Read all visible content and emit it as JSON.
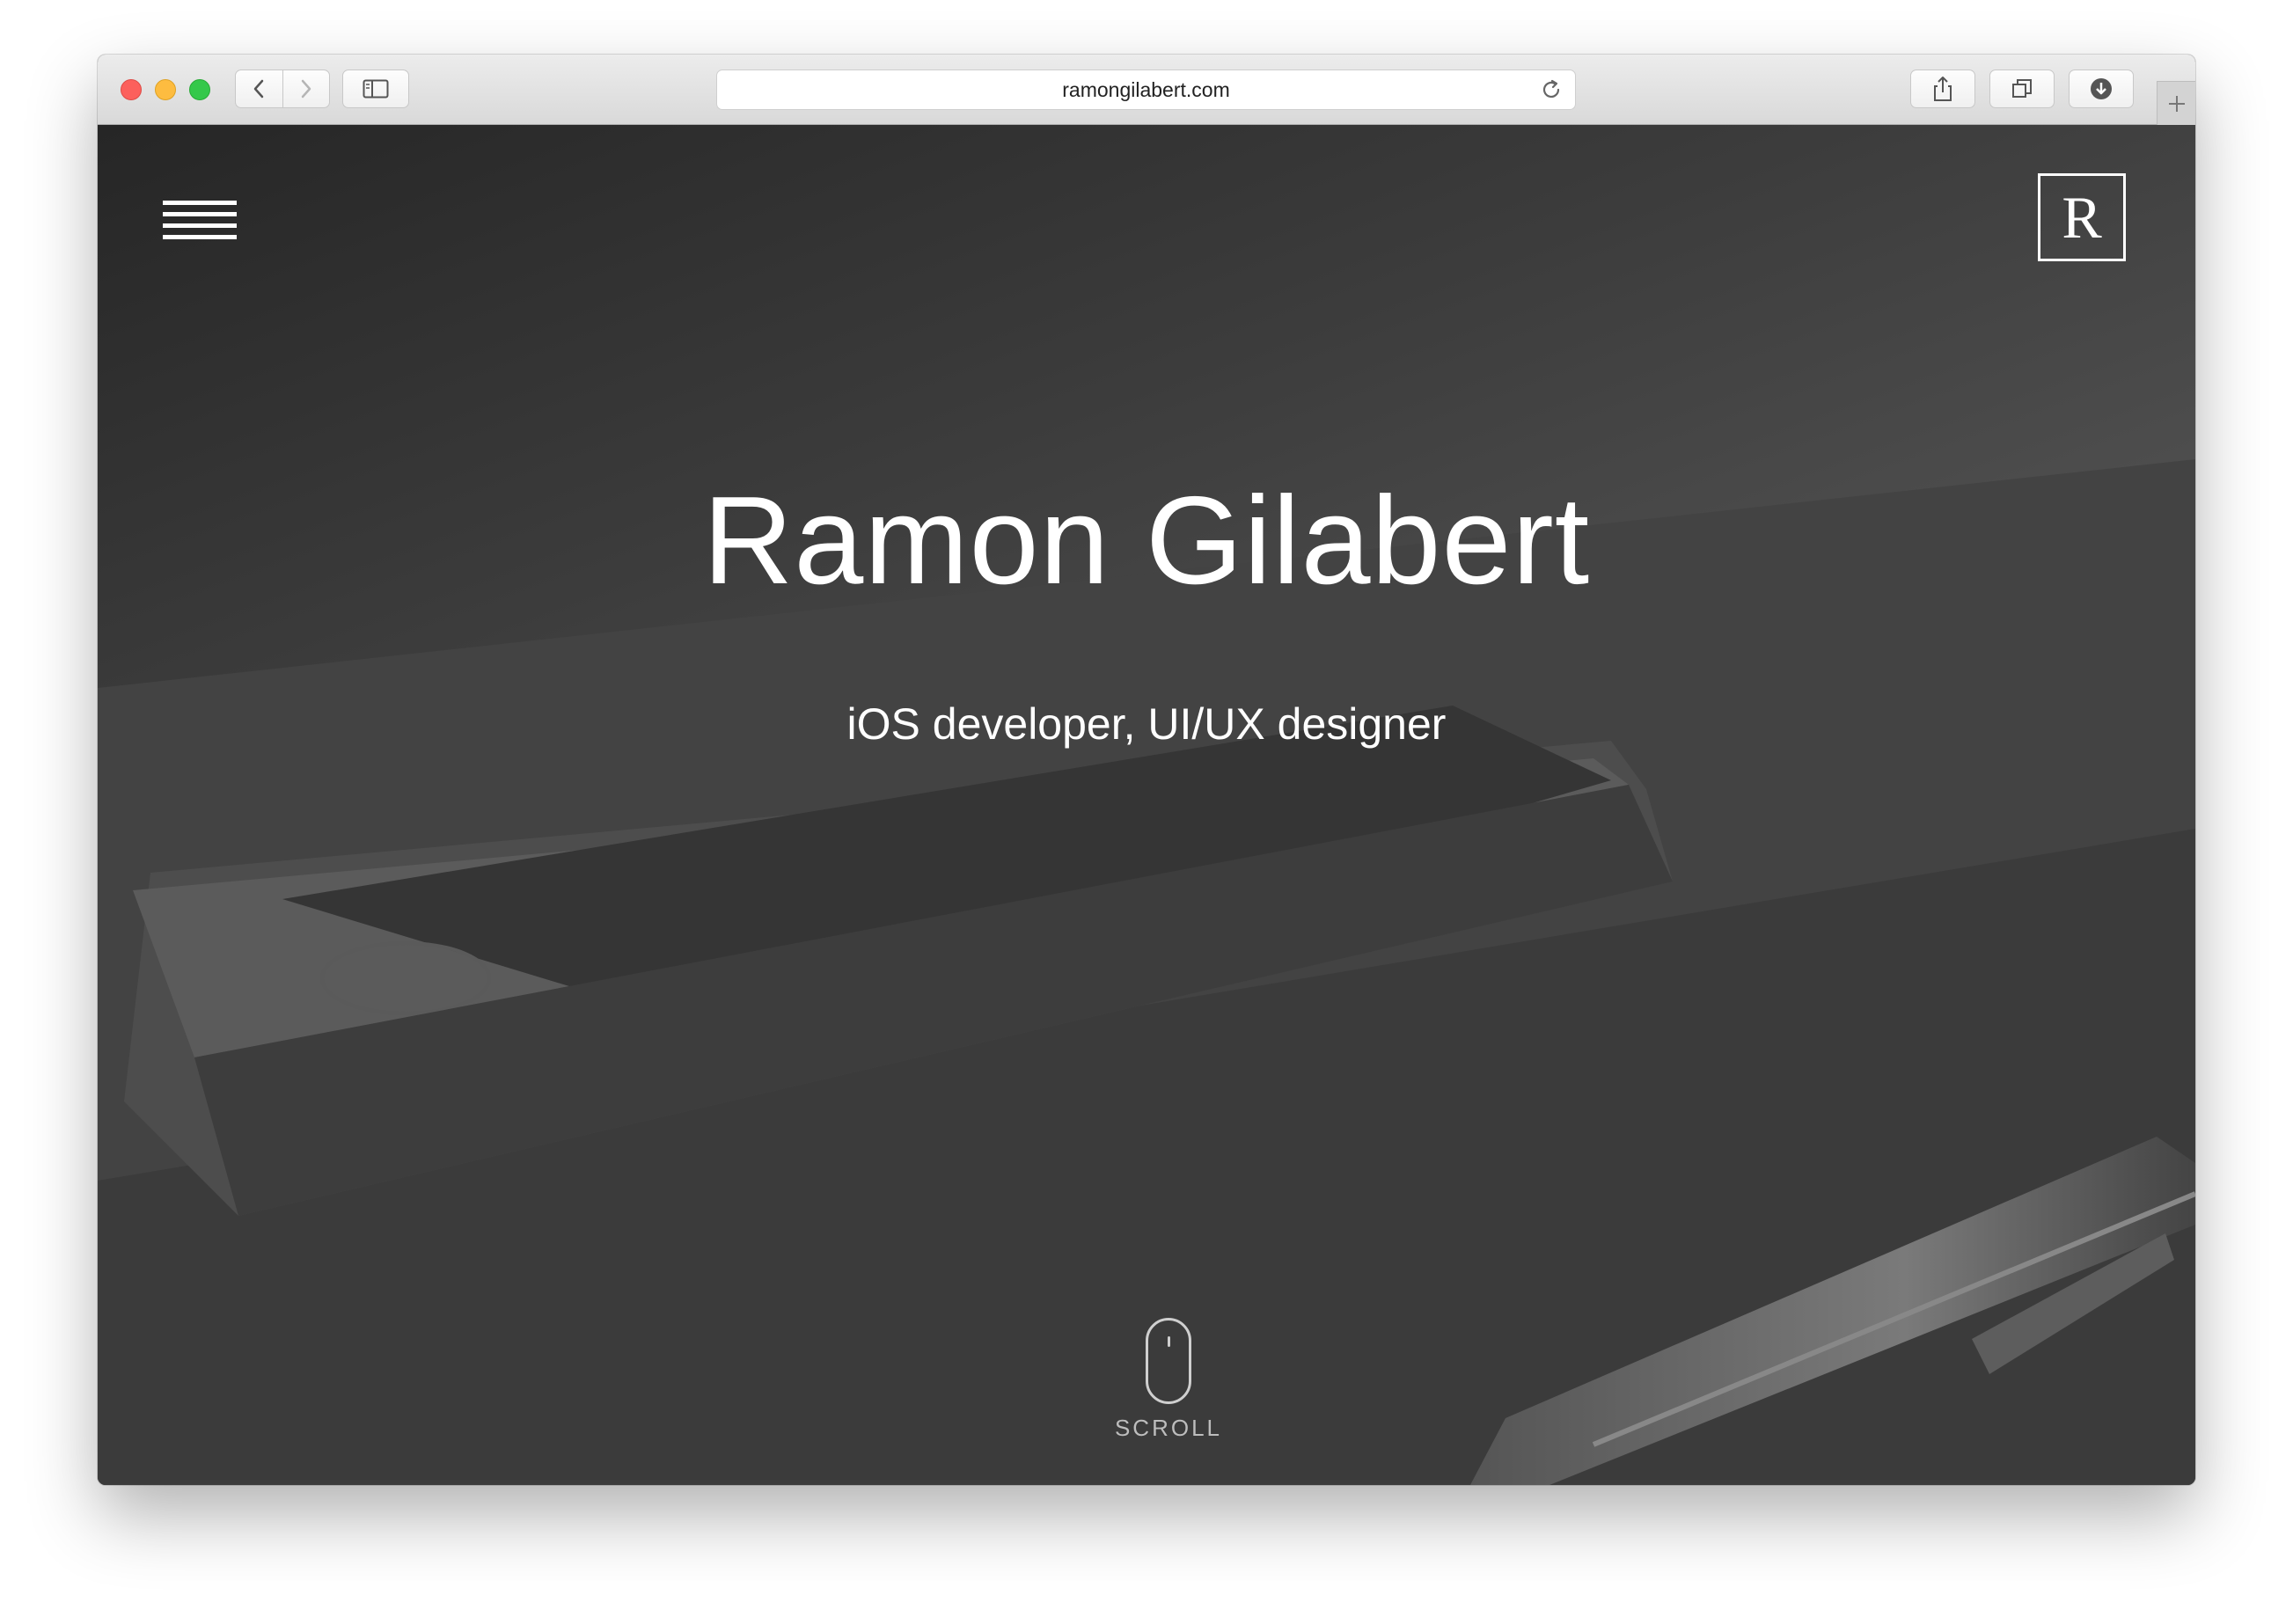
{
  "browser": {
    "url": "ramongilabert.com",
    "icons": {
      "back": "chevron-left-icon",
      "forward": "chevron-right-icon",
      "sidebar": "sidebar-icon",
      "reload": "reload-icon",
      "share": "share-icon",
      "tabs": "tabs-icon",
      "downloads": "download-icon",
      "new_tab": "plus-icon"
    }
  },
  "page": {
    "logo_letter": "R",
    "title": "Ramon Gilabert",
    "subtitle": "iOS developer, UI/UX designer",
    "scroll_label": "SCROLL"
  },
  "colors": {
    "close": "#fc605c",
    "minimize": "#fdbc40",
    "maximize": "#34c84a",
    "hero_text": "#ffffff"
  }
}
